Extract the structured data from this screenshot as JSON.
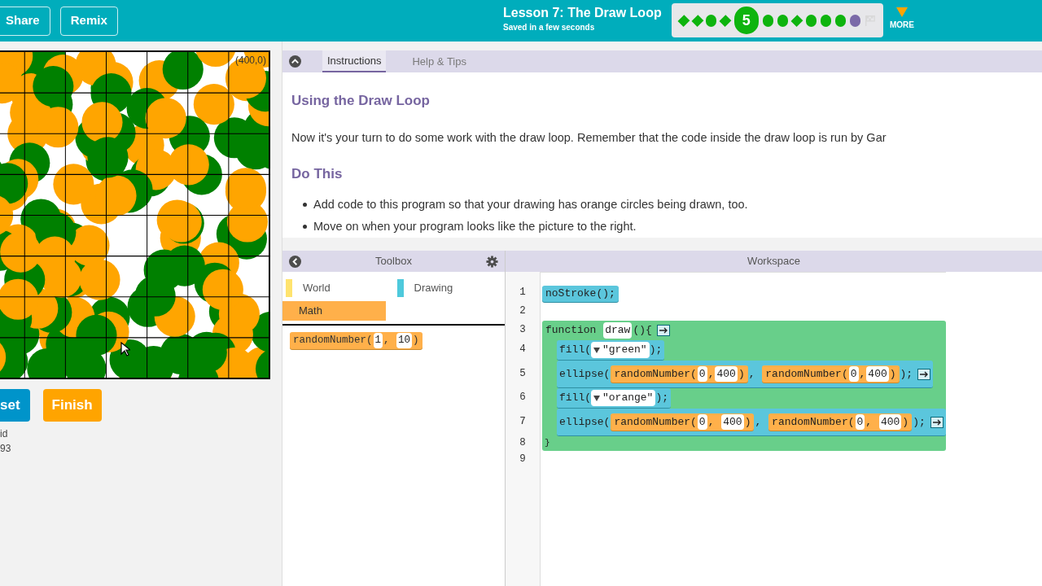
{
  "header": {
    "buttons": [
      "Share",
      "Remix"
    ],
    "lesson_title": "Lesson 7: The Draw Loop",
    "save_status": "Saved in a few seconds",
    "progress": [
      {
        "kind": "diamond",
        "color": "#0eb40e"
      },
      {
        "kind": "diamond",
        "color": "#0eb40e"
      },
      {
        "kind": "circle",
        "color": "#0eb40e"
      },
      {
        "kind": "diamond",
        "color": "#0eb40e"
      },
      {
        "kind": "current",
        "label": "5",
        "color": "#0eb40e"
      },
      {
        "kind": "circle",
        "color": "#0eb40e"
      },
      {
        "kind": "circle",
        "color": "#0eb40e"
      },
      {
        "kind": "diamond",
        "color": "#0eb40e"
      },
      {
        "kind": "circle",
        "color": "#0eb40e"
      },
      {
        "kind": "circle",
        "color": "#0eb40e"
      },
      {
        "kind": "circle",
        "color": "#0eb40e"
      },
      {
        "kind": "circle",
        "color": "#7b6aa8"
      },
      {
        "kind": "flag",
        "color": "#d8d8d8"
      }
    ],
    "more": "MORE"
  },
  "canvas": {
    "corner_label": "(400,0)"
  },
  "run_controls": {
    "buttons": [
      {
        "kind": "reset",
        "label": "set"
      },
      {
        "kind": "finish",
        "label": "Finish"
      }
    ],
    "notes": [
      "id",
      "93"
    ]
  },
  "instructions": {
    "tabs": [
      {
        "label": "Instructions",
        "selected": true
      },
      {
        "label": "Help & Tips",
        "selected": false
      }
    ],
    "title": "Using the Draw Loop",
    "text": "Now it's your turn to do some work with the draw loop. Remember that the code inside the draw loop is run by Gar",
    "subtitle": "Do This",
    "steps": [
      "Add code to this program so that your drawing has orange circles being drawn, too.",
      "Move on when your program looks like the picture to the right."
    ]
  },
  "toolbox": {
    "title": "Toolbox",
    "categories": [
      {
        "label": "World",
        "color": "#ffe36e",
        "selected": false
      },
      {
        "label": "Drawing",
        "color": "#4ec9dc",
        "selected": false
      },
      {
        "label": "Math",
        "color": "#ffb04a",
        "selected": true
      }
    ],
    "blocks": [
      {
        "kind": "call",
        "parts": [
          {
            "kind": "code",
            "text": "randomNumber("
          },
          {
            "kind": "arg",
            "text": "1"
          },
          {
            "kind": "code",
            "text": ", "
          },
          {
            "kind": "arg",
            "text": "10"
          },
          {
            "kind": "code",
            "text": ")"
          }
        ]
      }
    ]
  },
  "workspace": {
    "title": "Workspace",
    "blocks": [
      {
        "kind": "statement",
        "line": "1",
        "parts": [
          {
            "kind": "code",
            "text": "noStroke();"
          }
        ]
      },
      {
        "kind": "empty",
        "line": "2"
      },
      {
        "kind": "function",
        "line": "3",
        "end_line": "8",
        "end": "}",
        "parts": [
          {
            "kind": "code",
            "text": "function "
          },
          {
            "kind": "arg",
            "text": "draw"
          },
          {
            "kind": "code",
            "text": "(){"
          },
          {
            "kind": "arrow"
          }
        ],
        "children": [
          {
            "kind": "statement",
            "line": "4",
            "parts": [
              {
                "kind": "code",
                "text": "fill("
              },
              {
                "kind": "dropdown",
                "text": "\"green\""
              },
              {
                "kind": "code",
                "text": ");"
              }
            ]
          },
          {
            "kind": "statement",
            "line": "5",
            "parts": [
              {
                "kind": "code",
                "text": "ellipse("
              },
              {
                "kind": "call",
                "parts": [
                  {
                    "kind": "code",
                    "text": "randomNumber("
                  },
                  {
                    "kind": "arg",
                    "text": "0"
                  },
                  {
                    "kind": "code",
                    "text": ","
                  },
                  {
                    "kind": "arg",
                    "text": "400"
                  },
                  {
                    "kind": "code",
                    "text": ")"
                  }
                ]
              },
              {
                "kind": "code",
                "text": ", "
              },
              {
                "kind": "call",
                "parts": [
                  {
                    "kind": "code",
                    "text": "randomNumber("
                  },
                  {
                    "kind": "arg",
                    "text": "0"
                  },
                  {
                    "kind": "code",
                    "text": ","
                  },
                  {
                    "kind": "arg",
                    "text": "400"
                  },
                  {
                    "kind": "code",
                    "text": ")"
                  }
                ]
              },
              {
                "kind": "code",
                "text": ");"
              },
              {
                "kind": "arrow"
              }
            ]
          },
          {
            "kind": "statement",
            "line": "6",
            "parts": [
              {
                "kind": "code",
                "text": "fill("
              },
              {
                "kind": "dropdown",
                "text": "\"orange\""
              },
              {
                "kind": "code",
                "text": ");"
              }
            ]
          },
          {
            "kind": "statement",
            "line": "7",
            "parts": [
              {
                "kind": "code",
                "text": "ellipse("
              },
              {
                "kind": "call",
                "parts": [
                  {
                    "kind": "code",
                    "text": "randomNumber("
                  },
                  {
                    "kind": "arg",
                    "text": "0"
                  },
                  {
                    "kind": "code",
                    "text": ", "
                  },
                  {
                    "kind": "arg",
                    "text": "400"
                  },
                  {
                    "kind": "code",
                    "text": ")"
                  }
                ]
              },
              {
                "kind": "code",
                "text": ", "
              },
              {
                "kind": "call",
                "parts": [
                  {
                    "kind": "code",
                    "text": "randomNumber("
                  },
                  {
                    "kind": "arg",
                    "text": "0"
                  },
                  {
                    "kind": "code",
                    "text": ", "
                  },
                  {
                    "kind": "arg",
                    "text": "400"
                  },
                  {
                    "kind": "code",
                    "text": ")"
                  }
                ]
              },
              {
                "kind": "code",
                "text": ");"
              },
              {
                "kind": "arrow"
              }
            ]
          }
        ]
      },
      {
        "kind": "empty",
        "line": "9"
      }
    ]
  }
}
